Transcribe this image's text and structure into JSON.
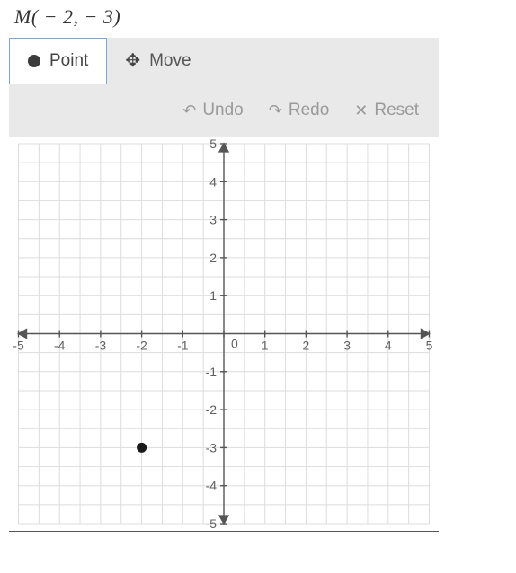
{
  "problem": {
    "label": "M( − 2, − 3)"
  },
  "toolbar": {
    "point_label": "Point",
    "move_label": "Move",
    "undo_label": "Undo",
    "redo_label": "Redo",
    "reset_label": "Reset"
  },
  "chart_data": {
    "type": "scatter",
    "title": "",
    "xlabel": "",
    "ylabel": "",
    "xlim": [
      -5,
      5
    ],
    "ylim": [
      -5,
      5
    ],
    "x_ticks": [
      -5,
      -4,
      -3,
      -2,
      -1,
      0,
      1,
      2,
      3,
      4,
      5
    ],
    "y_ticks": [
      -5,
      -4,
      -3,
      -2,
      -1,
      1,
      2,
      3,
      4,
      5
    ],
    "series": [
      {
        "name": "M",
        "values": [
          {
            "x": -2,
            "y": -3
          }
        ]
      }
    ],
    "grid": true
  }
}
